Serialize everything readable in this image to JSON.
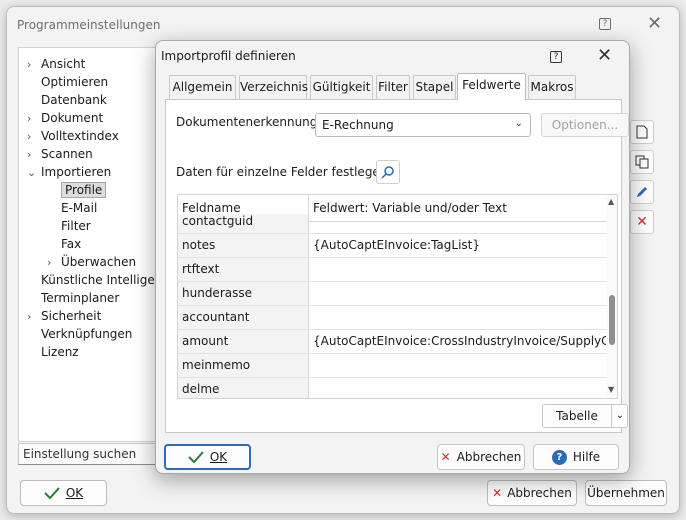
{
  "background_window": {
    "title": "Programmeinstellungen",
    "tree": [
      {
        "label": "Ansicht",
        "chevron": "›",
        "indent": 0
      },
      {
        "label": "Optimieren",
        "chevron": "",
        "indent": 0
      },
      {
        "label": "Datenbank",
        "chevron": "",
        "indent": 0
      },
      {
        "label": "Dokument",
        "chevron": "›",
        "indent": 0
      },
      {
        "label": "Volltextindex",
        "chevron": "›",
        "indent": 0
      },
      {
        "label": "Scannen",
        "chevron": "›",
        "indent": 0
      },
      {
        "label": "Importieren",
        "chevron": "⌄",
        "indent": 0
      },
      {
        "label": "Profile",
        "chevron": "",
        "indent": 1,
        "selected": true
      },
      {
        "label": "E-Mail",
        "chevron": "",
        "indent": 1
      },
      {
        "label": "Filter",
        "chevron": "",
        "indent": 1
      },
      {
        "label": "Fax",
        "chevron": "",
        "indent": 1
      },
      {
        "label": "Überwachen",
        "chevron": "›",
        "indent": 1
      },
      {
        "label": "Künstliche Intelligenz",
        "chevron": "",
        "indent": 0
      },
      {
        "label": "Terminplaner",
        "chevron": "",
        "indent": 0
      },
      {
        "label": "Sicherheit",
        "chevron": "›",
        "indent": 0
      },
      {
        "label": "Verknüpfungen",
        "chevron": "",
        "indent": 0
      },
      {
        "label": "Lizenz",
        "chevron": "",
        "indent": 0
      }
    ],
    "search_value": "Einstellung suchen",
    "ok_label": "OK",
    "cancel_label": "Abbrechen",
    "apply_label": "Übernehmen",
    "side_icons": [
      "new-document-icon",
      "copy-icon",
      "edit-pencil-icon",
      "delete-x-icon"
    ]
  },
  "dialog": {
    "title": "Importprofil definieren",
    "tabs": [
      "Allgemein",
      "Verzeichnis",
      "Gültigkeit",
      "Filter",
      "Stapel",
      "Feldwerte",
      "Makros"
    ],
    "active_tab": "Feldwerte",
    "doc_recognition_label": "Dokumentenerkennung",
    "doc_recognition_value": "E-Rechnung",
    "options_label": "Optionen...",
    "fields_label": "Daten für einzelne Felder festlegen",
    "grid": {
      "headers": [
        "Feldname",
        "Feldwert: Variable und/oder Text"
      ],
      "rows": [
        {
          "name": "contactguid",
          "value": ""
        },
        {
          "name": "notes",
          "value": "{AutoCaptEInvoice:TagList}"
        },
        {
          "name": "rtftext",
          "value": ""
        },
        {
          "name": "hunderasse",
          "value": ""
        },
        {
          "name": "accountant",
          "value": ""
        },
        {
          "name": "amount",
          "value": "{AutoCaptEInvoice:CrossIndustryInvoice/SupplyChain"
        },
        {
          "name": "meinmemo",
          "value": ""
        },
        {
          "name": "delme",
          "value": ""
        }
      ]
    },
    "table_button": "Tabelle",
    "ok_label": "OK",
    "cancel_label": "Abbrechen",
    "help_label": "Hilfe"
  }
}
